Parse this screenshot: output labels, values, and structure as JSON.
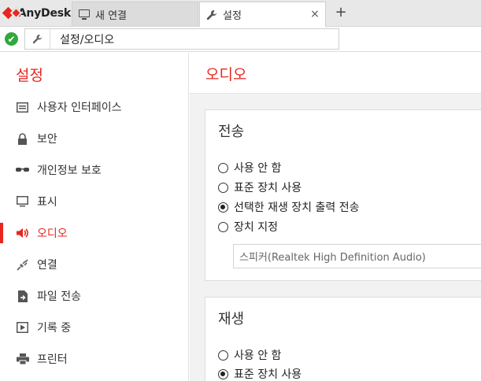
{
  "app": {
    "name": "AnyDesk",
    "brand_color": "#e8261f"
  },
  "tabs": [
    {
      "label": "새 연결",
      "icon": "monitor-icon",
      "active": false
    },
    {
      "label": "설정",
      "icon": "wrench-icon",
      "active": true,
      "close": "×"
    }
  ],
  "tab_add": "+",
  "address": {
    "status": "connected-check-icon",
    "status_color": "#31a83b",
    "check": "✔",
    "value": "설정/오디오"
  },
  "sidebar": {
    "title": "설정",
    "items": [
      {
        "label": "사용자 인터페이스",
        "icon": "interface-icon",
        "active": false
      },
      {
        "label": "보안",
        "icon": "lock-icon",
        "active": false
      },
      {
        "label": "개인정보 보호",
        "icon": "glasses-icon",
        "active": false
      },
      {
        "label": "표시",
        "icon": "monitor-icon",
        "active": false
      },
      {
        "label": "오디오",
        "icon": "speaker-icon",
        "active": true
      },
      {
        "label": "연결",
        "icon": "plug-icon",
        "active": false
      },
      {
        "label": "파일 전송",
        "icon": "file-transfer-icon",
        "active": false
      },
      {
        "label": "기록 중",
        "icon": "recording-icon",
        "active": false
      },
      {
        "label": "프린터",
        "icon": "printer-icon",
        "active": false
      }
    ]
  },
  "main": {
    "title": "오디오",
    "send": {
      "title": "전송",
      "options": [
        {
          "label": "사용 안 함",
          "checked": false
        },
        {
          "label": "표준 장치 사용",
          "checked": false
        },
        {
          "label": "선택한 재생 장치 출력 전송",
          "checked": true
        },
        {
          "label": "장치 지정",
          "checked": false
        }
      ],
      "device_select": "스피커(Realtek High Definition Audio)"
    },
    "playback": {
      "title": "재생",
      "options": [
        {
          "label": "사용 안 함",
          "checked": false
        },
        {
          "label": "표준 장치 사용",
          "checked": true
        }
      ]
    }
  }
}
